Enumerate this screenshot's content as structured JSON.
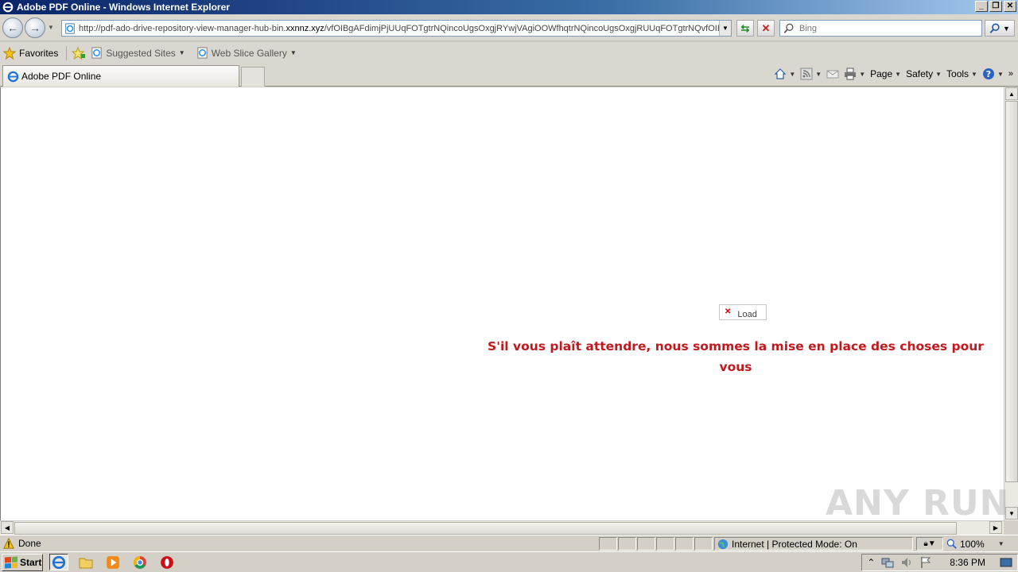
{
  "window": {
    "title": "Adobe PDF Online - Windows Internet Explorer"
  },
  "address": {
    "url_prefix": "http://pdf-ado-drive-repository-view-manager-hub-bin.",
    "url_domain": "xxnnz.xyz",
    "url_path": "/vfOIBgAFdimjPjUUqFOTgtrNQincoUgsOxgjRYwjVAgiOOWfhqtrNQincoUgsOxgjRUUqFOTgtrNQvfOIBgAFdimjPjUU"
  },
  "search": {
    "placeholder": "Bing"
  },
  "favorites": {
    "label": "Favorites",
    "items": [
      {
        "label": "Suggested Sites"
      },
      {
        "label": "Web Slice Gallery"
      }
    ]
  },
  "tab": {
    "title": "Adobe PDF Online"
  },
  "commandbar": {
    "page": "Page",
    "safety": "Safety",
    "tools": "Tools"
  },
  "content": {
    "broken_image_alt": "Load",
    "message": "S'il vous plaît attendre, nous sommes la mise en place des choses pour vous"
  },
  "watermark": "ANY RUN",
  "status": {
    "text": "Done",
    "zone": "Internet | Protected Mode: On",
    "zoom": "100%"
  },
  "taskbar": {
    "start": "Start",
    "clock": "8:36 PM"
  },
  "colors": {
    "message": "#c0191e",
    "titlebar": "#0a246a"
  }
}
